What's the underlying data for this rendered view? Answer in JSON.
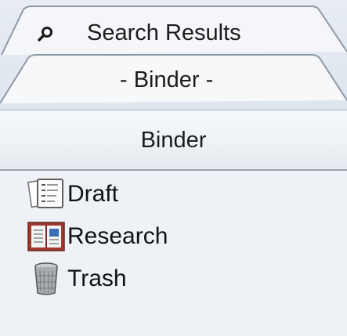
{
  "tabs": {
    "search": {
      "label": "Search Results",
      "icon": "search-icon"
    },
    "binder": {
      "label": "- Binder -"
    }
  },
  "header": {
    "title": "Binder"
  },
  "tree": {
    "items": [
      {
        "label": "Draft",
        "icon": "draft-document-icon"
      },
      {
        "label": "Research",
        "icon": "research-book-icon"
      },
      {
        "label": "Trash",
        "icon": "trash-bin-icon"
      }
    ]
  },
  "colors": {
    "background": "#eef2f7",
    "tab_border": "#8e98a4",
    "research_icon_accent": "#a0392f"
  }
}
